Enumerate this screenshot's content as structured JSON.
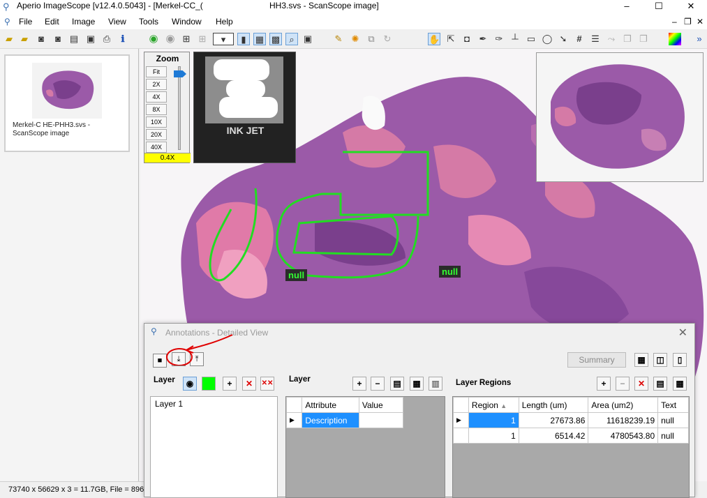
{
  "app": {
    "title_left": "Aperio ImageScope [v12.4.0.5043] - [Merkel-CC_(",
    "title_right": "HH3.svs - ScanScope image]",
    "min_label": "–",
    "max_label": "☐",
    "close_label": "✕"
  },
  "menu": [
    "File",
    "Edit",
    "Image",
    "View",
    "Tools",
    "Window",
    "Help"
  ],
  "mdi": {
    "min": "–",
    "restore": "❐",
    "close": "✕"
  },
  "thumbnail": {
    "caption": "Merkel-C HE-PHH3.svs - ScanScope image"
  },
  "zoom": {
    "title": "Zoom",
    "buttons": [
      "Fit",
      "2X",
      "4X",
      "8X",
      "10X",
      "20X",
      "40X"
    ],
    "current": "0.4X"
  },
  "slide_label": {
    "text": "INK JET"
  },
  "annotations_on_image": [
    "null",
    "null"
  ],
  "status": {
    "text": "73740 x 56629 x 3 = 11.7GB, File = 896I"
  },
  "dialog": {
    "title": "Annotations - Detailed View",
    "close": "✕",
    "summary_label": "Summary",
    "layer_header": "Layer",
    "layer_header2": "Layer",
    "regions_header": "Layer Regions",
    "layers": [
      "Layer 1"
    ],
    "attr_columns": [
      "Attribute",
      "Value"
    ],
    "attr_rows": [
      {
        "attribute": "Description",
        "value": ""
      }
    ],
    "region_columns": [
      "Region",
      "Length (um)",
      "Area (um2)",
      "Text"
    ],
    "region_rows": [
      {
        "region": "1",
        "length": "27673.86",
        "area": "11618239.19",
        "text": "null"
      },
      {
        "region": "1",
        "length": "6514.42",
        "area": "4780543.80",
        "text": "null"
      }
    ],
    "layer_color": "#00ff00"
  },
  "colors": {
    "tissue": "#9b5aa8",
    "annotation": "#22dd22",
    "highlight": "#1e90ff"
  }
}
